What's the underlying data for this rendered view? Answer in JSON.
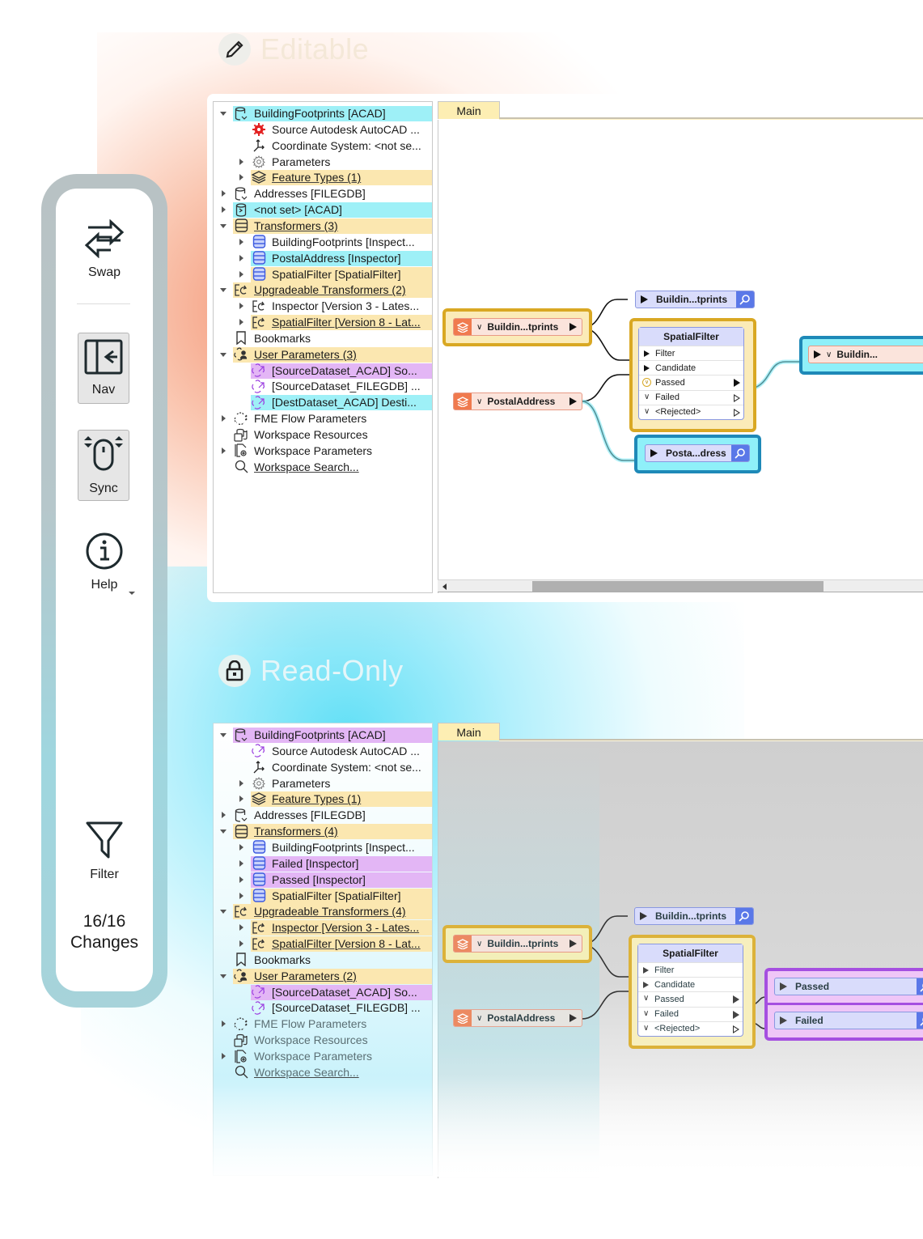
{
  "toolbar": {
    "swap_label": "Swap",
    "nav_label": "Nav",
    "sync_label": "Sync",
    "help_label": "Help",
    "filter_label": "Filter",
    "changes_count": "16/16",
    "changes_label": "Changes"
  },
  "editable": {
    "title": "Editable",
    "tree": [
      {
        "label": "BuildingFootprints [ACAD]",
        "highlight": "cyan"
      },
      {
        "label": "Source Autodesk AutoCAD ..."
      },
      {
        "label": "Coordinate System: <not se..."
      },
      {
        "label": "Parameters"
      },
      {
        "label": "Feature Types (1)",
        "highlight": "yellow"
      },
      {
        "label": "Addresses [FILEGDB]"
      },
      {
        "label": "<not set> [ACAD]",
        "highlight": "cyan"
      },
      {
        "label": "Transformers (3)",
        "highlight": "yellow"
      },
      {
        "label": "BuildingFootprints [Inspect..."
      },
      {
        "label": "PostalAddress [Inspector]",
        "highlight": "cyan"
      },
      {
        "label": "SpatialFilter [SpatialFilter]",
        "highlight": "yellow"
      },
      {
        "label": "Upgradeable Transformers (2)",
        "highlight": "yellow"
      },
      {
        "label": "Inspector [Version 3 - Lates..."
      },
      {
        "label": "SpatialFilter [Version 8 - Lat...",
        "highlight": "yellow"
      },
      {
        "label": "Bookmarks"
      },
      {
        "label": "User Parameters (3)",
        "highlight": "yellow"
      },
      {
        "label": "[SourceDataset_ACAD] So...",
        "highlight": "purple"
      },
      {
        "label": "[SourceDataset_FILEGDB] ..."
      },
      {
        "label": "[DestDataset_ACAD] Desti...",
        "highlight": "cyan"
      },
      {
        "label": "FME Flow Parameters"
      },
      {
        "label": "Workspace Resources"
      },
      {
        "label": "Workspace Parameters"
      },
      {
        "label": "Workspace Search..."
      }
    ],
    "tab": "Main",
    "canvas": {
      "reader1": "Buildin...tprints",
      "reader2": "PostalAddress",
      "inspector1": "Buildin...tprints",
      "inspector2": "Posta...dress",
      "writer": "Buildin...",
      "spatialfilter": {
        "title": "SpatialFilter",
        "ports": [
          "Filter",
          "Candidate",
          "Passed",
          "Failed",
          "<Rejected>"
        ]
      }
    }
  },
  "readonly": {
    "title": "Read-Only",
    "tree": [
      {
        "label": "BuildingFootprints [ACAD]",
        "highlight": "purple"
      },
      {
        "label": "Source Autodesk AutoCAD ..."
      },
      {
        "label": "Coordinate System: <not se..."
      },
      {
        "label": "Parameters"
      },
      {
        "label": "Feature Types (1)",
        "highlight": "yellow"
      },
      {
        "label": "Addresses [FILEGDB]"
      },
      {
        "label": "Transformers (4)",
        "highlight": "yellow"
      },
      {
        "label": "BuildingFootprints [Inspect..."
      },
      {
        "label": "Failed [Inspector]",
        "highlight": "purple"
      },
      {
        "label": "Passed [Inspector]",
        "highlight": "purple"
      },
      {
        "label": "SpatialFilter [SpatialFilter]",
        "highlight": "yellow"
      },
      {
        "label": "Upgradeable Transformers (4)",
        "highlight": "yellow"
      },
      {
        "label": "Inspector [Version 3 - Lates...",
        "highlight": "yellow"
      },
      {
        "label": "SpatialFilter [Version 8 - Lat...",
        "highlight": "yellow"
      },
      {
        "label": "Bookmarks"
      },
      {
        "label": "User Parameters (2)",
        "highlight": "yellow"
      },
      {
        "label": "[SourceDataset_ACAD] So...",
        "highlight": "purple"
      },
      {
        "label": "[SourceDataset_FILEGDB] ..."
      },
      {
        "label": "FME Flow Parameters"
      },
      {
        "label": "Workspace Resources"
      },
      {
        "label": "Workspace Parameters"
      },
      {
        "label": "Workspace Search..."
      }
    ],
    "tab": "Main",
    "canvas": {
      "reader1": "Buildin...tprints",
      "reader2": "PostalAddress",
      "inspector1": "Buildin...tprints",
      "inspector_passed": "Passed",
      "inspector_failed": "Failed",
      "spatialfilter": {
        "title": "SpatialFilter",
        "ports": [
          "Filter",
          "Candidate",
          "Passed",
          "Failed",
          "<Rejected>"
        ]
      }
    }
  },
  "colors": {
    "highlight_cyan": "#9ef0f7",
    "highlight_yellow": "#fbe7b0",
    "highlight_purple": "#e3b6f5",
    "bookmark_gold": "#d9a823",
    "bookmark_blue": "#1e89b8",
    "bookmark_purple": "#a54fe0"
  }
}
